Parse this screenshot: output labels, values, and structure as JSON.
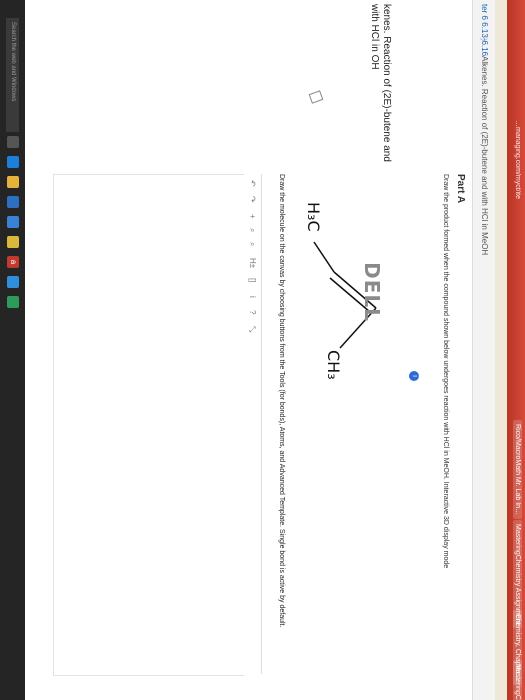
{
  "browser": {
    "url_text": "…managing.com/myct/ite",
    "tabs": [
      "Rico/MacroMath Mr. Lab In…",
      "MasteringChemistry Assignment",
      "Chemistry, Chapter…",
      "MasteringChem"
    ]
  },
  "breadcrumb": {
    "range": "ter 6 6.13-6.16",
    "separator": "〉",
    "title": "Alkenes. Reaction of (2E)-butene and with HCl in MeOH"
  },
  "question_panel": {
    "title": "kenes. Reaction of (2E)-butene and with HCl in OH"
  },
  "part": {
    "label": "Part A",
    "instruction": "Draw the product formed when the compound shown below undergoes reaction with HCl in MeOH. Interactive 3D display mode",
    "info_icon": "i",
    "molecule_left": "H₃C",
    "molecule_right": "CH₃",
    "canvas_instruction": "Draw the molecule on the canvas by choosing buttons from the Tools (for bonds), Atoms, and Advanced Template. Single bond is active by default.",
    "toolbar": [
      "↶",
      "↷",
      "+",
      "⌕",
      "⌕",
      "H±",
      "[]",
      "i",
      "?",
      "⤡"
    ]
  },
  "taskbar": {
    "search_placeholder": "Search the web and Windows",
    "icons": [
      "task-view",
      "edge",
      "file-explorer",
      "store",
      "mail",
      "chrome",
      "a",
      "ie",
      "app"
    ]
  },
  "bezel": {
    "logo": "DELL"
  }
}
